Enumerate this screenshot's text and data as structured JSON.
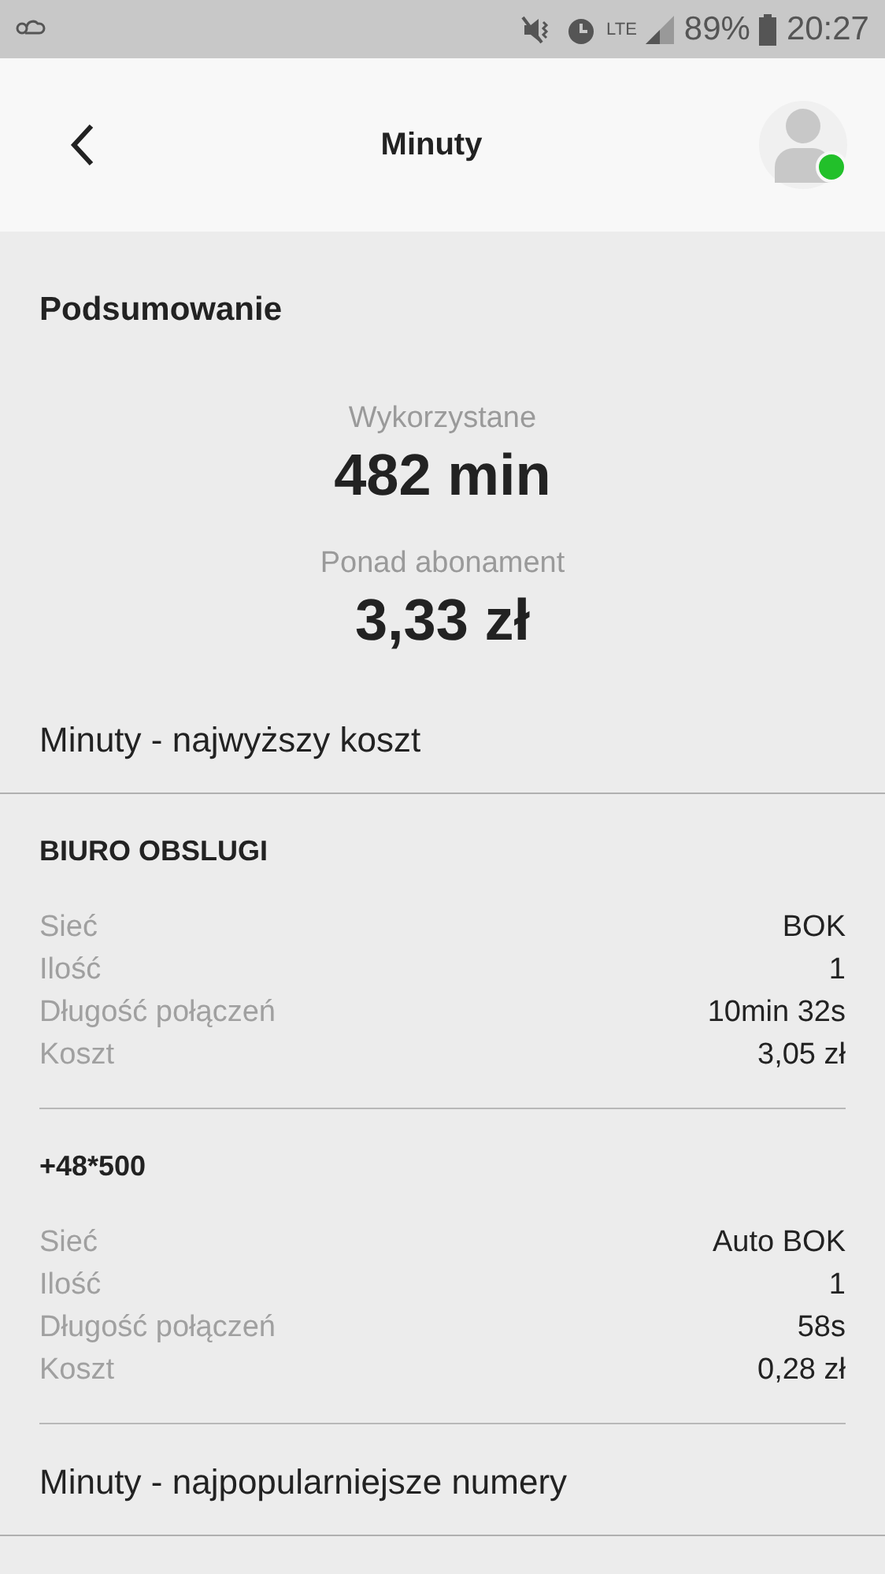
{
  "status_bar": {
    "network": "LTE",
    "battery": "89%",
    "time": "20:27"
  },
  "header": {
    "title": "Minuty",
    "avatar": {
      "online": true
    }
  },
  "summary": {
    "title": "Podsumowanie",
    "stats": [
      {
        "label": "Wykorzystane",
        "value": "482 min"
      },
      {
        "label": "Ponad abonament",
        "value": "3,33 zł"
      }
    ]
  },
  "top_cost": {
    "title": "Minuty - najwyższy koszt",
    "entries": [
      {
        "name": "BIURO OBSLUGI",
        "rows": [
          {
            "label": "Sieć",
            "value": "BOK"
          },
          {
            "label": "Ilość",
            "value": "1"
          },
          {
            "label": "Długość połączeń",
            "value": "10min 32s"
          },
          {
            "label": "Koszt",
            "value": "3,05 zł"
          }
        ]
      },
      {
        "name": "+48*500",
        "rows": [
          {
            "label": "Sieć",
            "value": "Auto BOK"
          },
          {
            "label": "Ilość",
            "value": "1"
          },
          {
            "label": "Długość połączeń",
            "value": "58s"
          },
          {
            "label": "Koszt",
            "value": "0,28 zł"
          }
        ]
      }
    ]
  },
  "popular": {
    "title": "Minuty - najpopularniejsze numery"
  }
}
